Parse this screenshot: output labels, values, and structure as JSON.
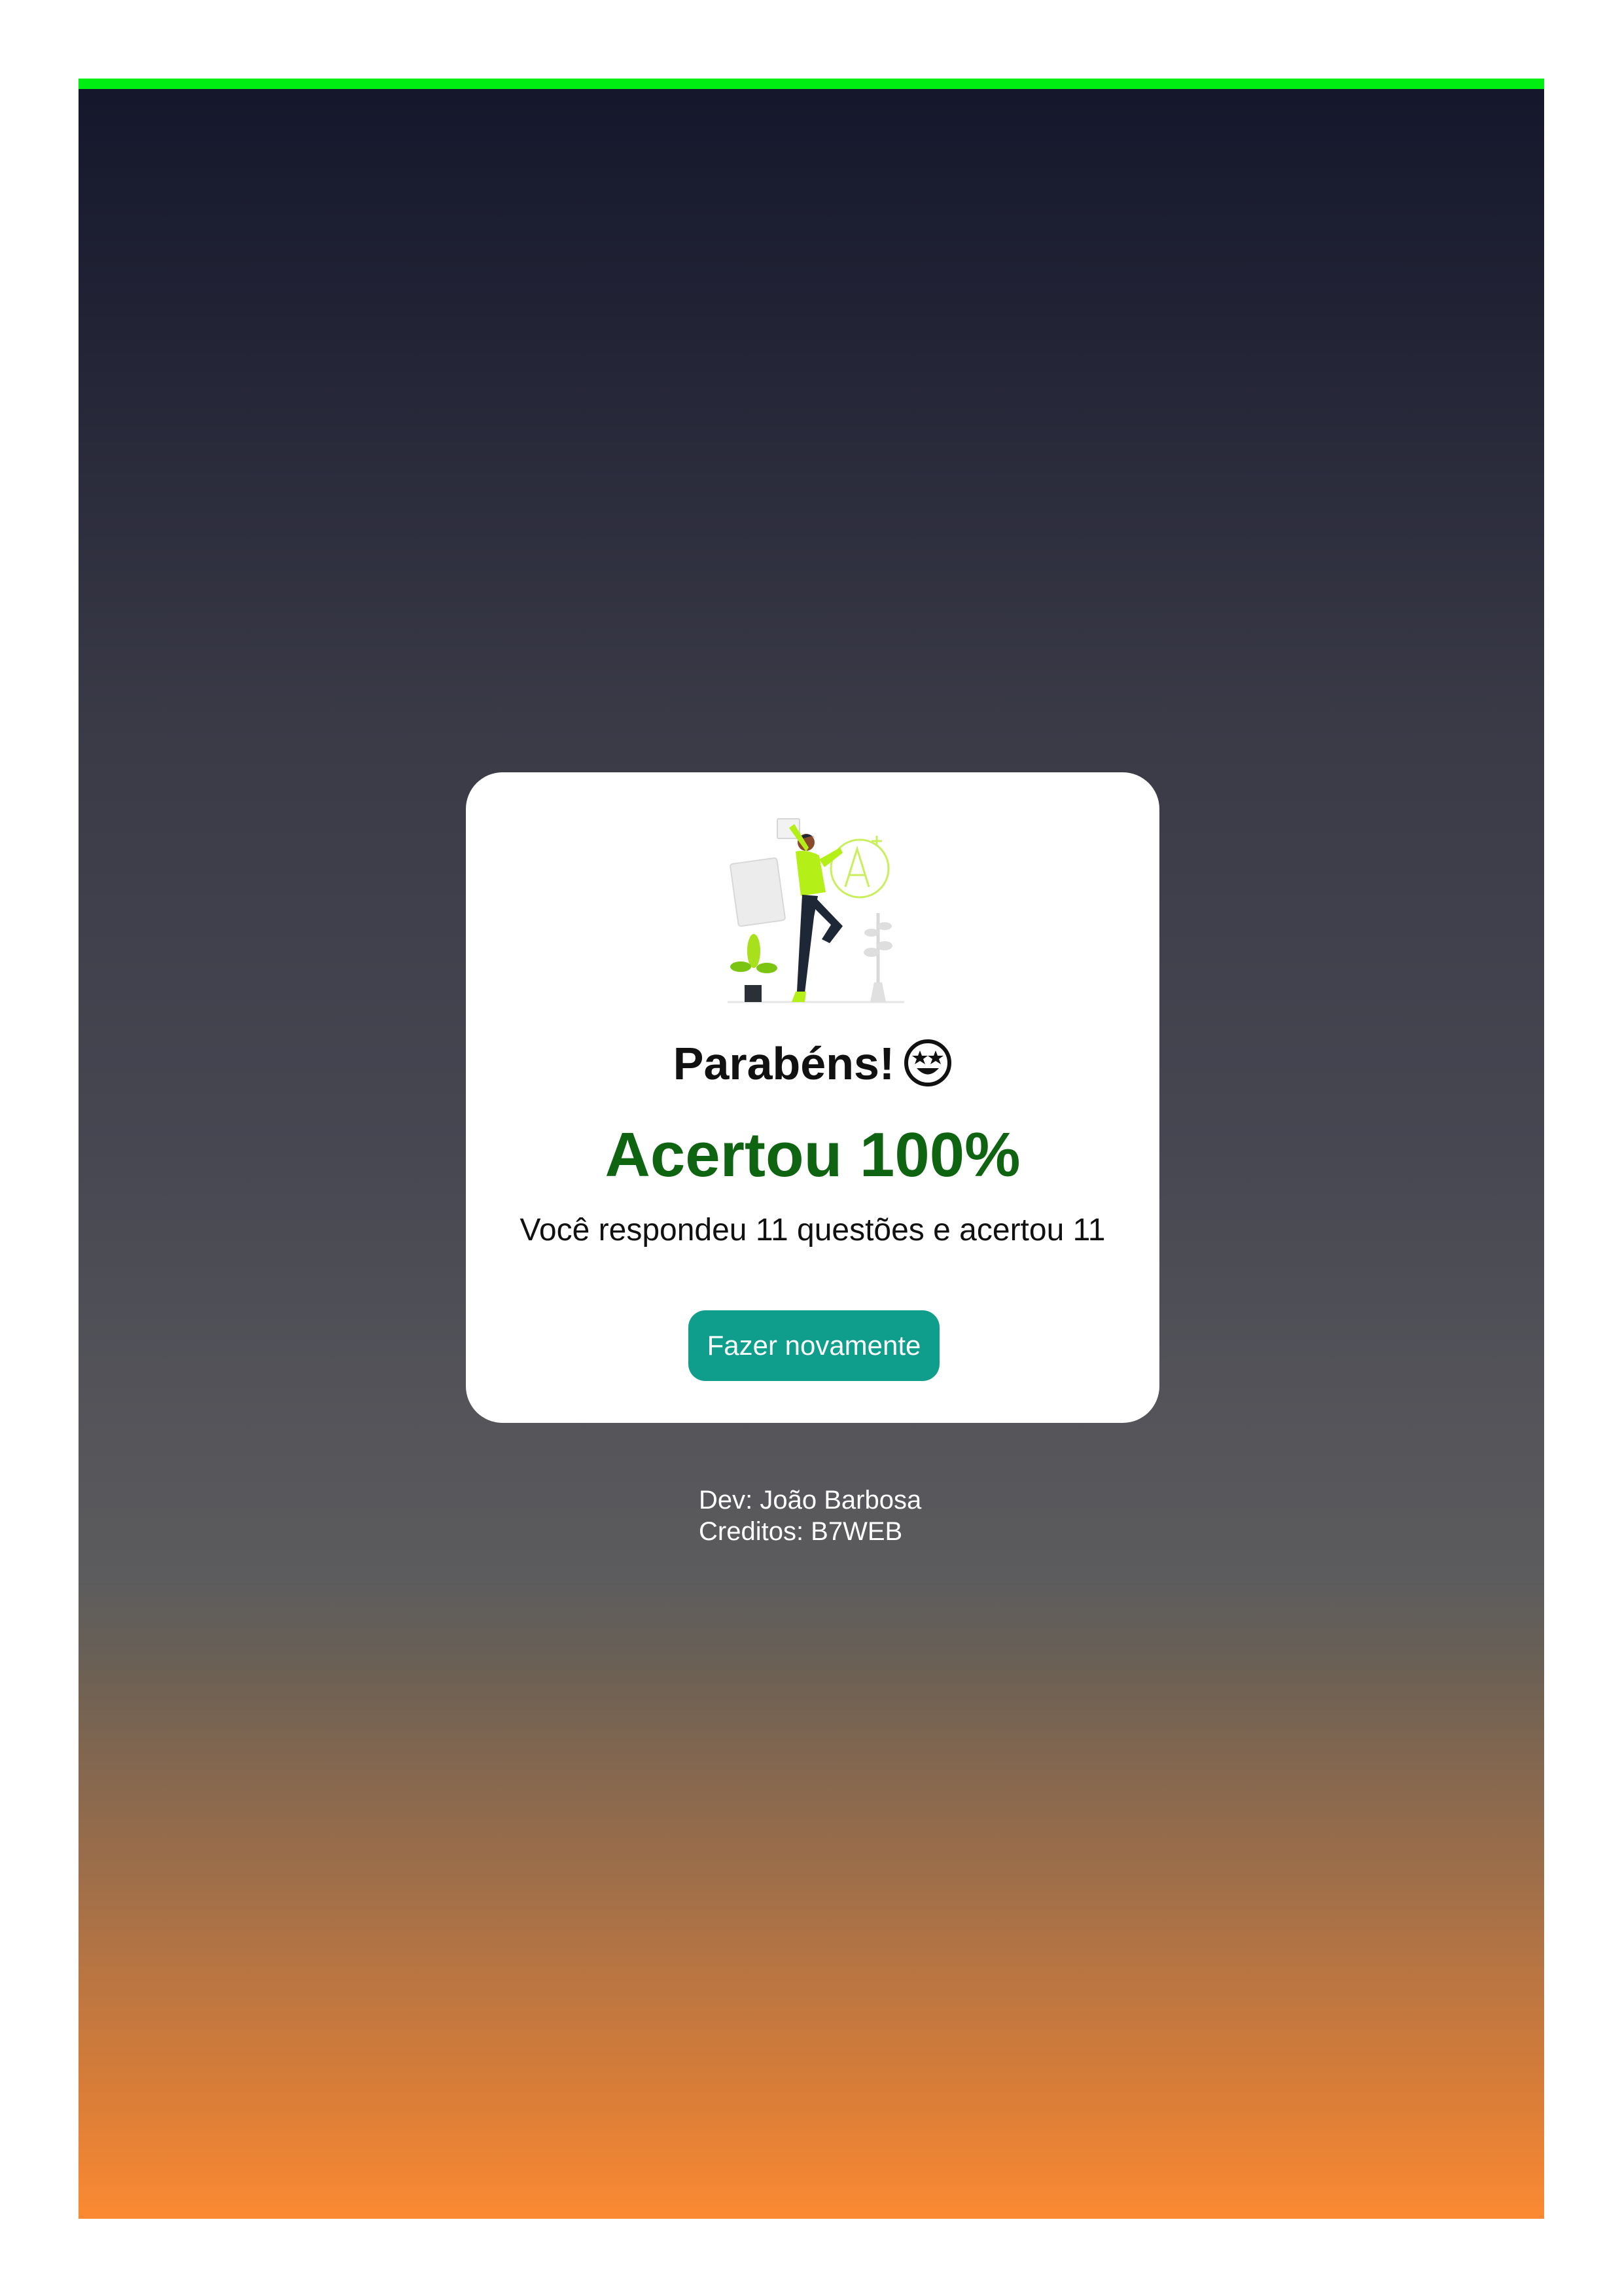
{
  "progress": {
    "percent": 100,
    "color": "#00ee11"
  },
  "result": {
    "title": "Parabéns!",
    "emoji_icon": "star-struck-face-icon",
    "score": "Acertou 100%",
    "summary": "Você respondeu 11 questões e acertou 11",
    "retry_label": "Fazer novamente"
  },
  "footer": {
    "dev": "Dev: João Barbosa",
    "credits": "Creditos: B7WEB"
  },
  "colors": {
    "accent": "#0f9e8c",
    "score": "#0e6411",
    "illustration": "#b4f018"
  }
}
